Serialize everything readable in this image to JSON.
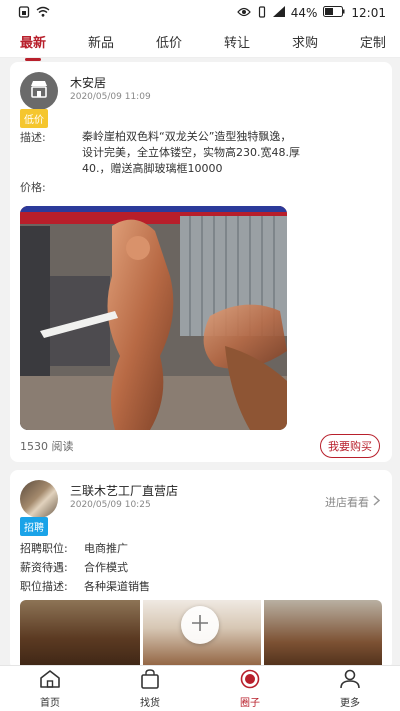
{
  "status": {
    "battery": "44%",
    "time": "12:01"
  },
  "tabs": [
    {
      "label": "最新",
      "active": true
    },
    {
      "label": "新品"
    },
    {
      "label": "低价"
    },
    {
      "label": "转让"
    },
    {
      "label": "求购"
    },
    {
      "label": "定制"
    }
  ],
  "post1": {
    "name": "木安居",
    "date": "2020/05/09 11:09",
    "tag": "低价",
    "desc_label": "描述:",
    "description": "秦岭崖柏双色料“双龙关公”造型独特飘逸，设计完美，全立体镂空，实物高230.宽48.厚40.，赠送高脚玻璃框10000",
    "price_label": "价格:",
    "reads": "1530 阅读",
    "buy_label": "我要购买"
  },
  "post2": {
    "name": "三联木艺工厂直营店",
    "date": "2020/05/09 10:25",
    "tag": "招聘",
    "visit_label": "进店看看",
    "rows": [
      {
        "key": "招聘职位:",
        "value": "电商推广"
      },
      {
        "key": "薪资待遇:",
        "value": "合作模式"
      },
      {
        "key": "职位描述:",
        "value": "各种渠道销售"
      }
    ]
  },
  "nav": [
    {
      "label": "首页",
      "icon": "home-icon"
    },
    {
      "label": "找货",
      "icon": "bag-icon"
    },
    {
      "label": "圈子",
      "icon": "circle-icon",
      "active": true
    },
    {
      "label": "更多",
      "icon": "user-icon"
    }
  ],
  "colors": {
    "accent": "#b8202c",
    "tag_yellow": "#f5c62e",
    "tag_blue": "#1aa3e8"
  }
}
